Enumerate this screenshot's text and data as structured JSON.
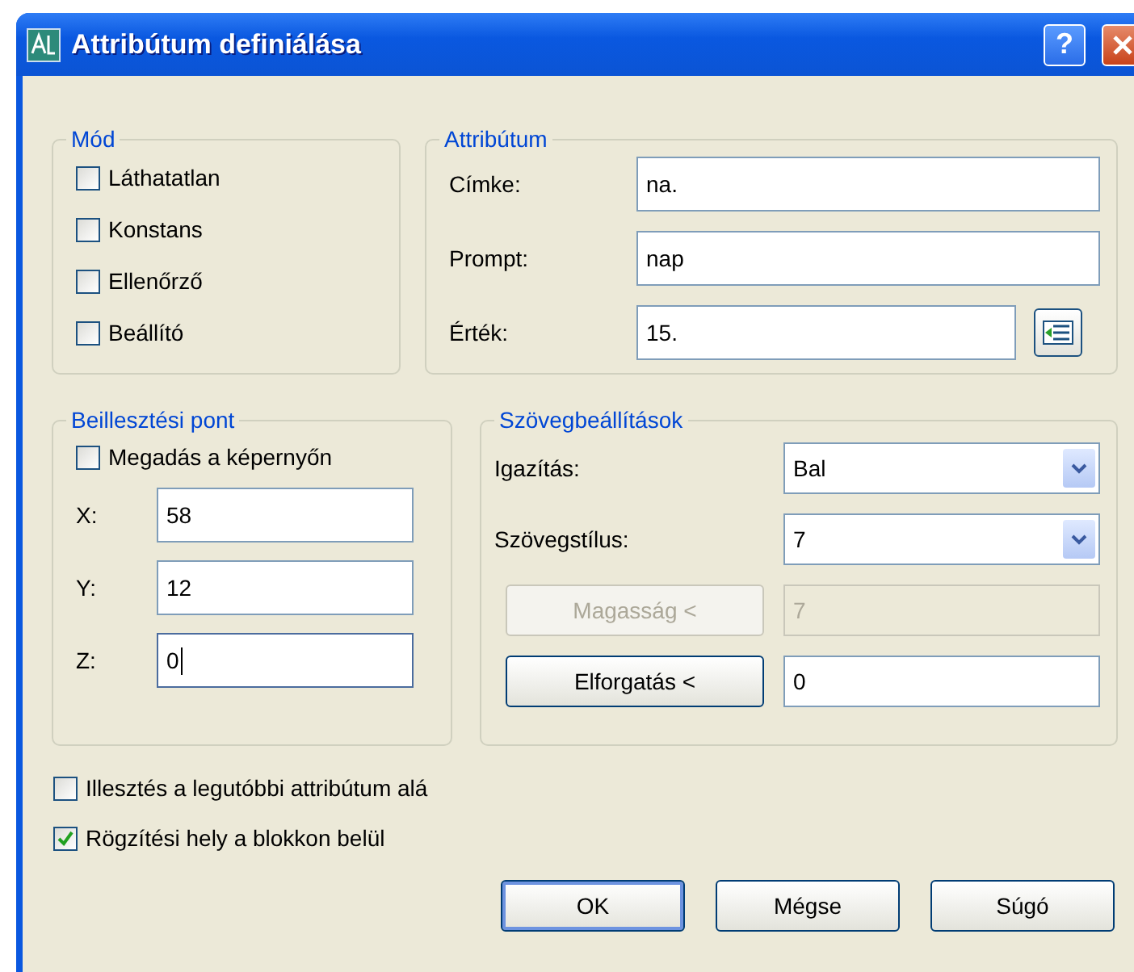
{
  "window": {
    "title": "Attribútum definiálása",
    "help_label": "?"
  },
  "mode": {
    "title": "Mód",
    "options": [
      {
        "label": "Láthatatlan",
        "checked": false
      },
      {
        "label": "Konstans",
        "checked": false
      },
      {
        "label": "Ellenőrző",
        "checked": false
      },
      {
        "label": "Beállító",
        "checked": false
      }
    ]
  },
  "attribute": {
    "title": "Attribútum",
    "fields": [
      {
        "label": "Címke:",
        "value": "na.",
        "has_button": false
      },
      {
        "label": "Prompt:",
        "value": "nap",
        "has_button": false
      },
      {
        "label": "Érték:",
        "value": "15.",
        "has_button": true
      }
    ]
  },
  "insertion_point": {
    "title": "Beillesztési pont",
    "on_screen": {
      "label": "Megadás a képernyőn",
      "checked": false
    },
    "coords": [
      {
        "label": "X:",
        "value": "58",
        "focused": false
      },
      {
        "label": "Y:",
        "value": "12",
        "focused": false
      },
      {
        "label": "Z:",
        "value": "0",
        "focused": true
      }
    ]
  },
  "text_settings": {
    "title": "Szövegbeállítások",
    "rows": [
      {
        "kind": "dropdown",
        "label": "Igazítás:",
        "value": "Bal",
        "disabled": false
      },
      {
        "kind": "dropdown",
        "label": "Szövegstílus:",
        "value": "7",
        "disabled": false
      },
      {
        "kind": "pick",
        "label": "Magasság <",
        "value": "7",
        "disabled": true
      },
      {
        "kind": "pick",
        "label": "Elforgatás <",
        "value": "0",
        "disabled": false
      }
    ]
  },
  "options": [
    {
      "label": "Illesztés a legutóbbi attribútum alá",
      "checked": false
    },
    {
      "label": "Rögzítési hely a blokkon belül",
      "checked": true
    }
  ],
  "buttons": [
    {
      "label": "OK",
      "default": true
    },
    {
      "label": "Mégse",
      "default": false
    },
    {
      "label": "Súgó",
      "default": false
    }
  ]
}
